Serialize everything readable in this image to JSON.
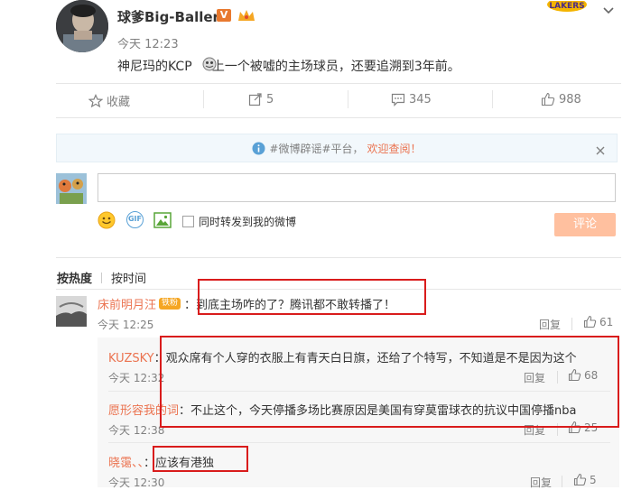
{
  "post": {
    "username": "球爹Big-Baller",
    "time": "今天 12:23",
    "content": "神尼玛的KCP     上一个被嘘的主场球员，还要追溯到3年前。"
  },
  "actions": {
    "favorite": "收藏",
    "repost": "5",
    "comment": "345",
    "like": "988"
  },
  "notice": {
    "prefix": "#微博辟谣#平台，",
    "link": "欢迎查阅！"
  },
  "compose": {
    "input_value": "",
    "gif_label": "GIF",
    "repost_checkbox": "同时转发到我的微博",
    "submit": "评论"
  },
  "sort": {
    "hot": "按热度",
    "time": "按时间"
  },
  "comments": [
    {
      "nick": "床前明月汪",
      "badge": "铁粉",
      "text": "：到底主场咋的了？腾讯都不敢转播了！",
      "time": "今天 12:25",
      "reply": "回复",
      "likes": "61"
    }
  ],
  "replies": [
    {
      "nick": "KUZSKY",
      "text": "：观众席有个人穿的衣服上有青天白日旗，还给了个特写，不知道是不是因为这个",
      "time": "今天 12:32",
      "reply": "回复",
      "likes": "68"
    },
    {
      "nick": "愿形容我的词",
      "text": "：不止这个，今天停播多场比赛原因是美国有穿莫雷球衣的抗议中国停播nba",
      "time": "今天 12:38",
      "reply": "回复",
      "likes": "25"
    },
    {
      "nick": "晓霭、、",
      "text": "：应该有港独",
      "time": "今天 12:30",
      "reply": "回复",
      "likes": "5"
    }
  ],
  "colors": {
    "accent": "#eb7350",
    "annotation": "#d91c1c",
    "notice_bg": "#f2f8fc"
  }
}
